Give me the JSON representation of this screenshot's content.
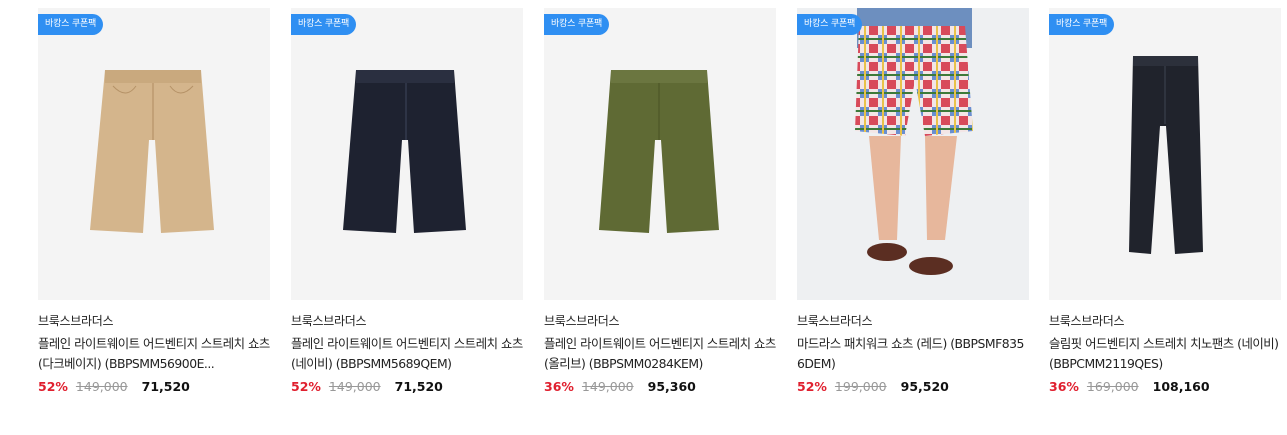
{
  "products": [
    {
      "badge": "바캉스 쿠폰팩",
      "brand": "브룩스브라더스",
      "title": "플레인 라이트웨이트 어드벤티지 스트레치 쇼츠 (다크베이지) (BBPSMM56900E...",
      "discount": "52%",
      "original_price": "149,000",
      "sale_price": "71,520",
      "image": "beige-shorts"
    },
    {
      "badge": "바캉스 쿠폰팩",
      "brand": "브룩스브라더스",
      "title": "플레인 라이트웨이트 어드벤티지 스트레치 쇼츠 (네이비) (BBPSMM5689QEM)",
      "discount": "52%",
      "original_price": "149,000",
      "sale_price": "71,520",
      "image": "navy-shorts"
    },
    {
      "badge": "바캉스 쿠폰팩",
      "brand": "브룩스브라더스",
      "title": "플레인 라이트웨이트 어드벤티지 스트레치 쇼츠 (올리브) (BBPSMM0284KEM)",
      "discount": "36%",
      "original_price": "149,000",
      "sale_price": "95,360",
      "image": "olive-shorts"
    },
    {
      "badge": "바캉스 쿠폰팩",
      "brand": "브룩스브라더스",
      "title": "마드라스 패치워크 쇼츠 (레드) (BBPSMF8356DEM)",
      "discount": "52%",
      "original_price": "199,000",
      "sale_price": "95,520",
      "image": "madras-shorts-model"
    },
    {
      "badge": "바캉스 쿠폰팩",
      "brand": "브룩스브라더스",
      "title": "슬림핏 어드벤티지 스트레치 치노팬츠 (네이비) (BBPCMM2119QES)",
      "discount": "36%",
      "original_price": "169,000",
      "sale_price": "108,160",
      "image": "navy-pants"
    }
  ],
  "colors": {
    "badge": "#2f8ff2",
    "discount": "#e0202f",
    "beige": "#d4b58c",
    "navy": "#1e2230",
    "olive": "#5f6a34",
    "pants": "#20232c"
  }
}
